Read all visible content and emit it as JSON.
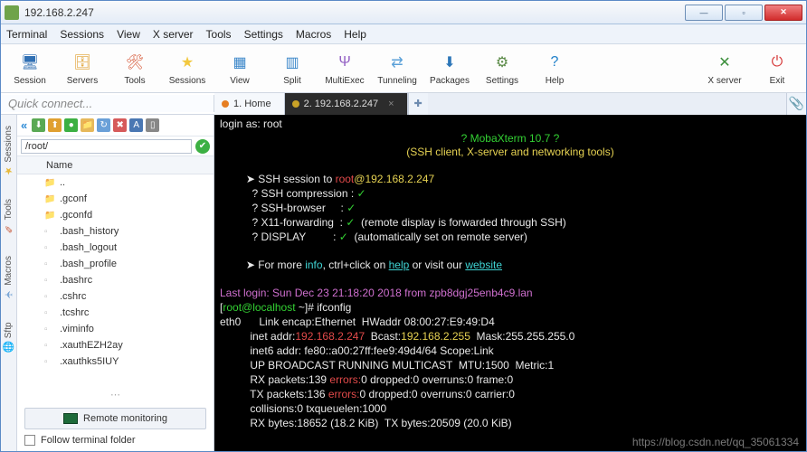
{
  "window": {
    "title": "192.168.2.247"
  },
  "win_buttons": {
    "min": "—",
    "max": "▫",
    "close": "✕"
  },
  "menu": [
    "Terminal",
    "Sessions",
    "View",
    "X server",
    "Tools",
    "Settings",
    "Macros",
    "Help"
  ],
  "toolbar": {
    "left": [
      {
        "label": "Session",
        "icon": "🖥",
        "color": "#2f6fb3"
      },
      {
        "label": "Servers",
        "icon": "🗄",
        "color": "#e0a030"
      },
      {
        "label": "Tools",
        "icon": "🛠",
        "color": "#d65a3a"
      },
      {
        "label": "Sessions",
        "icon": "★",
        "color": "#f2c83f"
      },
      {
        "label": "View",
        "icon": "▦",
        "color": "#3a86c9"
      },
      {
        "label": "Split",
        "icon": "▥",
        "color": "#3a86c9"
      },
      {
        "label": "MultiExec",
        "icon": "Ψ",
        "color": "#9462c4"
      },
      {
        "label": "Tunneling",
        "icon": "⇄",
        "color": "#5aa0d8"
      },
      {
        "label": "Packages",
        "icon": "⬇",
        "color": "#2c76b8"
      },
      {
        "label": "Settings",
        "icon": "⚙",
        "color": "#5a8a46"
      },
      {
        "label": "Help",
        "icon": "?",
        "color": "#1e7fc9"
      }
    ],
    "right": [
      {
        "label": "X server",
        "icon": "✕",
        "color": "#3c8f3c"
      },
      {
        "label": "Exit",
        "icon": "⏻",
        "color": "#d63a3a"
      }
    ]
  },
  "quick_connect_placeholder": "Quick connect...",
  "tabs": {
    "home": {
      "label": "1. Home"
    },
    "active": {
      "label": "2. 192.168.2.247"
    },
    "add": "✚",
    "clip": "📎"
  },
  "side_tabs": [
    {
      "label": "Sessions",
      "icon": "★",
      "color": "#e6b83a"
    },
    {
      "label": "Tools",
      "icon": "✎",
      "color": "#c85a3a"
    },
    {
      "label": "Macros",
      "icon": "✈",
      "color": "#7aa6d6"
    },
    {
      "label": "Sftp",
      "icon": "🌐",
      "color": "#56a056"
    }
  ],
  "sftp": {
    "path": "/root/",
    "header_name": "Name",
    "files": [
      {
        "name": "..",
        "icon": "📁",
        "color": "#e6b85a"
      },
      {
        "name": ".gconf",
        "icon": "📁",
        "color": "#e6b85a"
      },
      {
        "name": ".gconfd",
        "icon": "📁",
        "color": "#e6b85a"
      },
      {
        "name": ".bash_history",
        "icon": "▫",
        "color": "#bbb"
      },
      {
        "name": ".bash_logout",
        "icon": "▫",
        "color": "#bbb"
      },
      {
        "name": ".bash_profile",
        "icon": "▫",
        "color": "#bbb"
      },
      {
        "name": ".bashrc",
        "icon": "▫",
        "color": "#bbb"
      },
      {
        "name": ".cshrc",
        "icon": "▫",
        "color": "#bbb"
      },
      {
        "name": ".tcshrc",
        "icon": "▫",
        "color": "#bbb"
      },
      {
        "name": ".viminfo",
        "icon": "▫",
        "color": "#bbb"
      },
      {
        "name": ".xauthEZH2ay",
        "icon": "▫",
        "color": "#bbb"
      },
      {
        "name": ".xauthks5IUY",
        "icon": "▫",
        "color": "#bbb"
      }
    ],
    "remote_monitoring": "Remote monitoring",
    "follow": "Follow terminal folder"
  },
  "sftp_toolbar_icons": [
    {
      "glyph": "⬇",
      "bg": "#5aa954"
    },
    {
      "glyph": "⬆",
      "bg": "#e0a030"
    },
    {
      "glyph": "●",
      "bg": "#3cb043"
    },
    {
      "glyph": "📁",
      "bg": "#e6b85a"
    },
    {
      "glyph": "↻",
      "bg": "#6aa0d8"
    },
    {
      "glyph": "✖",
      "bg": "#d65a5a"
    },
    {
      "glyph": "A",
      "bg": "#4a77b3"
    },
    {
      "glyph": "▯",
      "bg": "#888"
    }
  ],
  "terminal": {
    "login_as": "login as: root",
    "banner_q": "? MobaXterm 10.7 ?",
    "banner_sub": "(SSH client, X-server and networking tools)",
    "ssh_session_prefix": "➤ SSH session to ",
    "ssh_user": "root",
    "ssh_at": "@",
    "ssh_host": "192.168.2.247",
    "ssh_compression": "  ? SSH compression : ",
    "ssh_browser": "  ? SSH-browser     : ",
    "x11": "  ? X11-forwarding  : ",
    "x11_note": "  (remote display is forwarded through SSH)",
    "display": "  ? DISPLAY         : ",
    "display_note": "  (automatically set on remote server)",
    "check": "✓",
    "more_prefix": "➤ For more ",
    "info": "info",
    "more_mid": ", ctrl+click on ",
    "help": "help",
    "more_mid2": " or visit our ",
    "website": "website",
    "last_login": "Last login: Sun Dec 23 21:18:20 2018 from zpb8dgj25enb4c9.lan",
    "prompt_open": "[",
    "prompt_user": "root@localhost",
    "prompt_path": " ~",
    "prompt_close": "]# ",
    "cmd": "ifconfig",
    "if_lines": {
      "l1a": "eth0      Link encap:Ethernet  HWaddr 08:00:27:E9:49:D4",
      "l2a": "          inet addr:",
      "l2b": "192.168.2.247",
      "l2c": "  Bcast:",
      "l2d": "192.168.2.255",
      "l2e": "  Mask:255.255.255.0",
      "l3": "          inet6 addr: fe80::a00:27ff:fee9:49d4/64 Scope:Link",
      "l4": "          UP BROADCAST RUNNING MULTICAST  MTU:1500  Metric:1",
      "l5a": "          RX packets:139 ",
      "l5b": "errors:",
      "l5c": "0 dropped:0 overruns:0 frame:0",
      "l6a": "          TX packets:136 ",
      "l6c": "0 dropped:0 overruns:0 carrier:0",
      "l7": "          collisions:0 txqueuelen:1000",
      "l8": "          RX bytes:18652 (18.2 KiB)  TX bytes:20509 (20.0 KiB)"
    }
  },
  "watermark": "https://blog.csdn.net/qq_35061334"
}
